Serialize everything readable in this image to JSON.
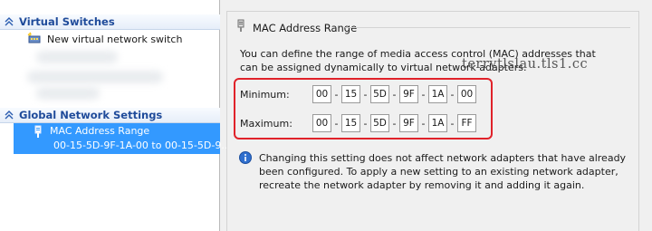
{
  "left": {
    "virtual_switches": {
      "title": "Virtual Switches",
      "items": [
        {
          "label": "New virtual network switch",
          "icon": "switch-icon"
        }
      ]
    },
    "global_settings": {
      "title": "Global Network Settings",
      "items": [
        {
          "label": "MAC Address Range",
          "sublabel": "00-15-5D-9F-1A-00 to 00-15-5D-9...",
          "icon": "network-adapter-icon",
          "selected": true
        }
      ]
    }
  },
  "right": {
    "title": "MAC Address Range",
    "description": "You can define the range of media access control (MAC) addresses that can be assigned dynamically to virtual network adapters.",
    "watermark": "terrytlslau.tls1.cc",
    "minimum": {
      "label": "Minimum:",
      "octets": [
        "00",
        "15",
        "5D",
        "9F",
        "1A",
        "00"
      ]
    },
    "maximum": {
      "label": "Maximum:",
      "octets": [
        "00",
        "15",
        "5D",
        "9F",
        "1A",
        "FF"
      ]
    },
    "info": "Changing this setting does not affect network adapters that have already been configured.  To apply a new setting to an existing network adapter, recreate the network adapter by removing it and adding it again."
  },
  "colors": {
    "accent": "#3399ff",
    "highlight": "#e0222a",
    "header_text": "#1f4b9a"
  }
}
